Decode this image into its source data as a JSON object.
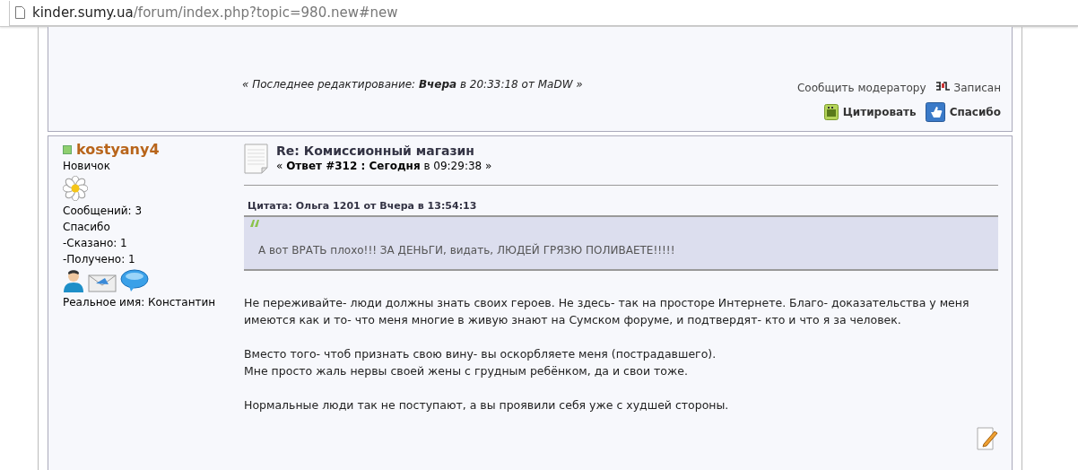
{
  "address_bar": {
    "domain": "kinder.sumy.ua",
    "path": "/forum/index.php?topic=980.new#new"
  },
  "previous_post": {
    "last_edit": "« Последнее редактирование: **Вчера** в 20:33:18 от MaDW »",
    "report_link": "Сообщить модератору",
    "status": "Записан",
    "buttons": [
      {
        "kind": "quote",
        "label": "Цитировать"
      },
      {
        "kind": "thanks",
        "label": "Спасибо"
      }
    ]
  },
  "post": {
    "author": {
      "name": "kostyany4",
      "online": true,
      "rank": "Новичок",
      "stats": [
        "Сообщений: 3",
        "Спасибо",
        "-Сказано: 1",
        "-Получено: 1"
      ],
      "real_name": "Реальное имя: Константин"
    },
    "title": "Re: Комиссионный магазин",
    "meta": "« **Ответ #312 : Сегодня** в 09:29:38 »",
    "quote": {
      "header": "Цитата: Ольга 1201 от Вчера в 13:54:13",
      "text": "А вот ВРАТЬ плохо!!! ЗА ДЕНЬГИ, видать, ЛЮДЕЙ ГРЯЗЮ ПОЛИВАЕТЕ!!!!!"
    },
    "paragraphs": [
      [
        "Не переживайте- люди должны знать своих героев. Не здесь- так на просторе Интернете. Благо- доказательства у меня имеются как и то- что меня многие в живую знают на Сумском форуме, и подтвердят- кто и что я за человек."
      ],
      [
        "Вместо того- чтоб признать свою вину- вы оскорбляете меня (пострадавшего).",
        "Мне просто жаль нервы своей жены с грудным ребёнком, да и свои тоже."
      ],
      [
        "Нормальные люди так не поступают, а вы проявили себя уже с худшей стороны."
      ]
    ]
  }
}
